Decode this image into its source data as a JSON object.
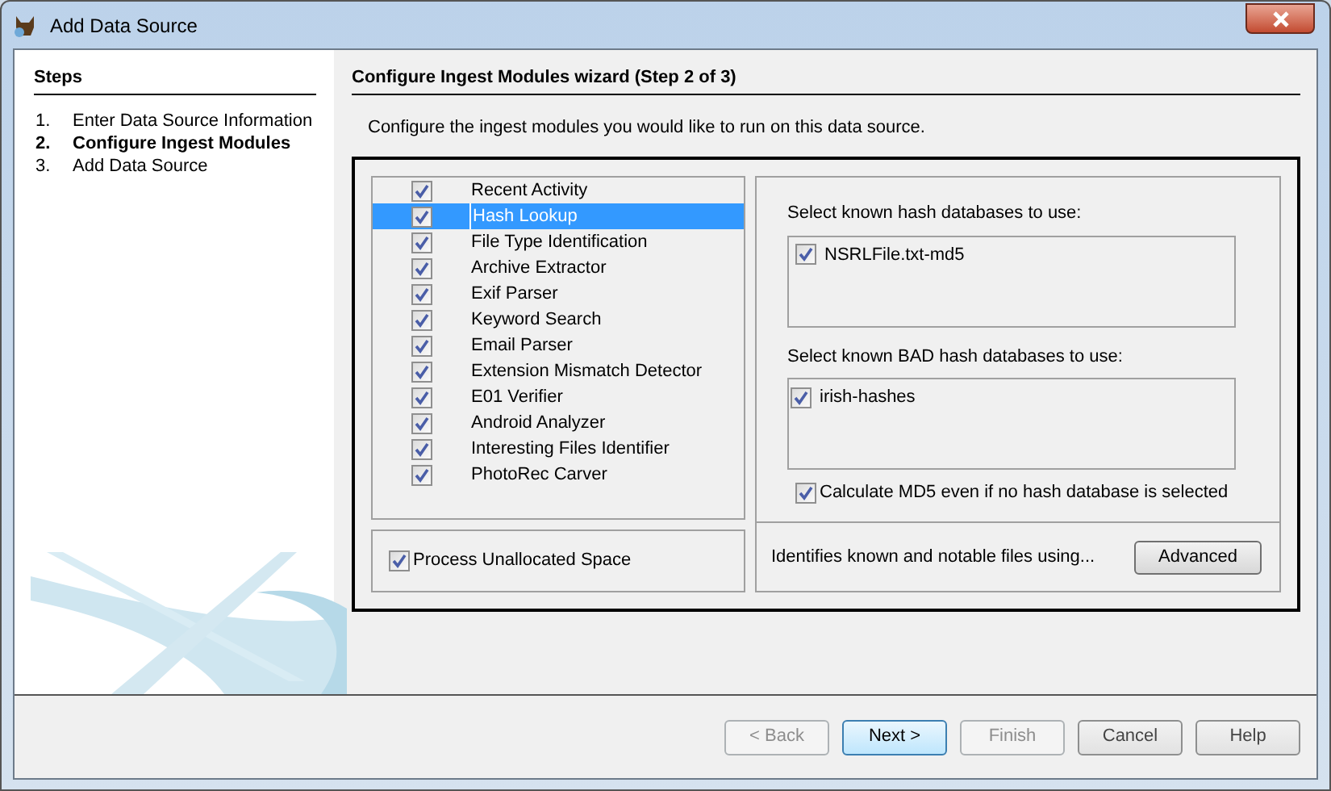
{
  "window": {
    "title": "Add Data Source"
  },
  "steps": {
    "heading": "Steps",
    "items": [
      {
        "number": "1.",
        "label": "Enter Data Source Information",
        "selected": false
      },
      {
        "number": "2.",
        "label": "Configure Ingest Modules",
        "selected": true
      },
      {
        "number": "3.",
        "label": "Add Data Source",
        "selected": false
      }
    ]
  },
  "panel": {
    "title": "Configure Ingest Modules wizard (Step 2 of 3)",
    "description": "Configure the ingest modules you would like to run on this data source.",
    "modules": [
      {
        "label": "Recent Activity",
        "checked": true,
        "selected": false
      },
      {
        "label": "Hash Lookup",
        "checked": true,
        "selected": true
      },
      {
        "label": "File Type Identification",
        "checked": true,
        "selected": false
      },
      {
        "label": "Archive Extractor",
        "checked": true,
        "selected": false
      },
      {
        "label": "Exif Parser",
        "checked": true,
        "selected": false
      },
      {
        "label": "Keyword Search",
        "checked": true,
        "selected": false
      },
      {
        "label": "Email Parser",
        "checked": true,
        "selected": false
      },
      {
        "label": "Extension Mismatch Detector",
        "checked": true,
        "selected": false
      },
      {
        "label": "E01 Verifier",
        "checked": true,
        "selected": false
      },
      {
        "label": "Android Analyzer",
        "checked": true,
        "selected": false
      },
      {
        "label": "Interesting Files Identifier",
        "checked": true,
        "selected": false
      },
      {
        "label": "PhotoRec Carver",
        "checked": true,
        "selected": false
      }
    ],
    "process_unallocated": {
      "label": "Process Unallocated Space",
      "checked": true
    },
    "settings": {
      "known_label": "Select known hash databases to use:",
      "known": [
        {
          "label": "NSRLFile.txt-md5",
          "checked": true
        }
      ],
      "bad_label": "Select known BAD hash databases to use:",
      "bad": [
        {
          "label": "irish-hashes",
          "checked": true
        }
      ],
      "calculate_md5": {
        "label": "Calculate MD5 even if no hash database is selected",
        "checked": true
      }
    },
    "module_description": "Identifies known and notable files using...",
    "advanced_button": "Advanced"
  },
  "buttons": [
    {
      "label": "< Back",
      "disabled": true,
      "default": false
    },
    {
      "label": "Next >",
      "disabled": false,
      "default": true
    },
    {
      "label": "Finish",
      "disabled": true,
      "default": false
    },
    {
      "label": "Cancel",
      "disabled": false,
      "default": false
    },
    {
      "label": "Help",
      "disabled": false,
      "default": false
    }
  ]
}
